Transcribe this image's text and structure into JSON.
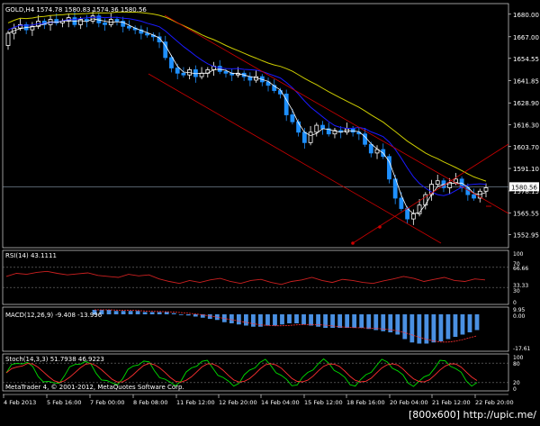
{
  "window": {
    "symbol_header": "GOLD,H4  1574.78 1580.83 1574.36 1580.56",
    "watermark": "[800x600] http://upic.me/"
  },
  "price_axis": {
    "ticks": [
      "1680.00",
      "1667.00",
      "1654.55",
      "1641.85",
      "1628.90",
      "1616.30",
      "1603.70",
      "1591.10",
      "1578.15",
      "1565.55",
      "1552.95"
    ],
    "current": "1580.56"
  },
  "rsi": {
    "label": "RSI(14) 43.1111",
    "ticks": [
      "100",
      "70",
      "66.66",
      "33.33",
      "30",
      "0"
    ]
  },
  "macd": {
    "label": "MACD(12,26,9) -9.408 -13.996",
    "ticks": [
      "9.95",
      "0.00",
      "-17.61"
    ]
  },
  "stoch": {
    "label": "Stoch(14,3,3) 51.7938 46.9223",
    "ticks": [
      "100",
      "80",
      "20",
      "0"
    ],
    "copyright": "MetaTrader 4, © 2001-2012, MetaQuotes Software Corp."
  },
  "time_axis": [
    "4 Feb 2013",
    "5 Feb 16:00",
    "7 Feb 00:00",
    "8 Feb 08:00",
    "11 Feb 12:00",
    "12 Feb 20:00",
    "14 Feb 04:00",
    "15 Feb 12:00",
    "18 Feb 16:00",
    "20 Feb 04:00",
    "21 Feb 12:00",
    "22 Feb 20:00"
  ],
  "colors": {
    "bg": "#000000",
    "grid": "#ffffff",
    "bull": "#ffffff",
    "bear": "#1e90ff",
    "ma_fast": "#ffffff",
    "ma_mid": "#1a1aff",
    "ma_slow": "#cccc00",
    "channel": "#cc0000",
    "hist": "#4a90e2",
    "signal": "#ff3030",
    "stoch_main": "#00dd00",
    "stoch_signal": "#ff3030"
  },
  "chart_data": {
    "type": "candlestick",
    "closes": [
      1669,
      1672,
      1674,
      1671,
      1673,
      1676,
      1674,
      1677,
      1675,
      1676,
      1678,
      1674,
      1677,
      1676,
      1679,
      1675,
      1674,
      1677,
      1676,
      1673,
      1672,
      1671,
      1669,
      1668,
      1667,
      1664,
      1655,
      1649,
      1646,
      1645,
      1648,
      1644,
      1646,
      1648,
      1650,
      1647,
      1646,
      1645,
      1646,
      1644,
      1642,
      1644,
      1641,
      1639,
      1636,
      1634,
      1622,
      1618,
      1612,
      1606,
      1612,
      1616,
      1614,
      1611,
      1613,
      1612,
      1614,
      1612,
      1611,
      1605,
      1600,
      1602,
      1598,
      1585,
      1574,
      1568,
      1562,
      1565,
      1570,
      1576,
      1582,
      1584,
      1580,
      1583,
      1585,
      1580,
      1576,
      1574,
      1578,
      1580
    ]
  }
}
